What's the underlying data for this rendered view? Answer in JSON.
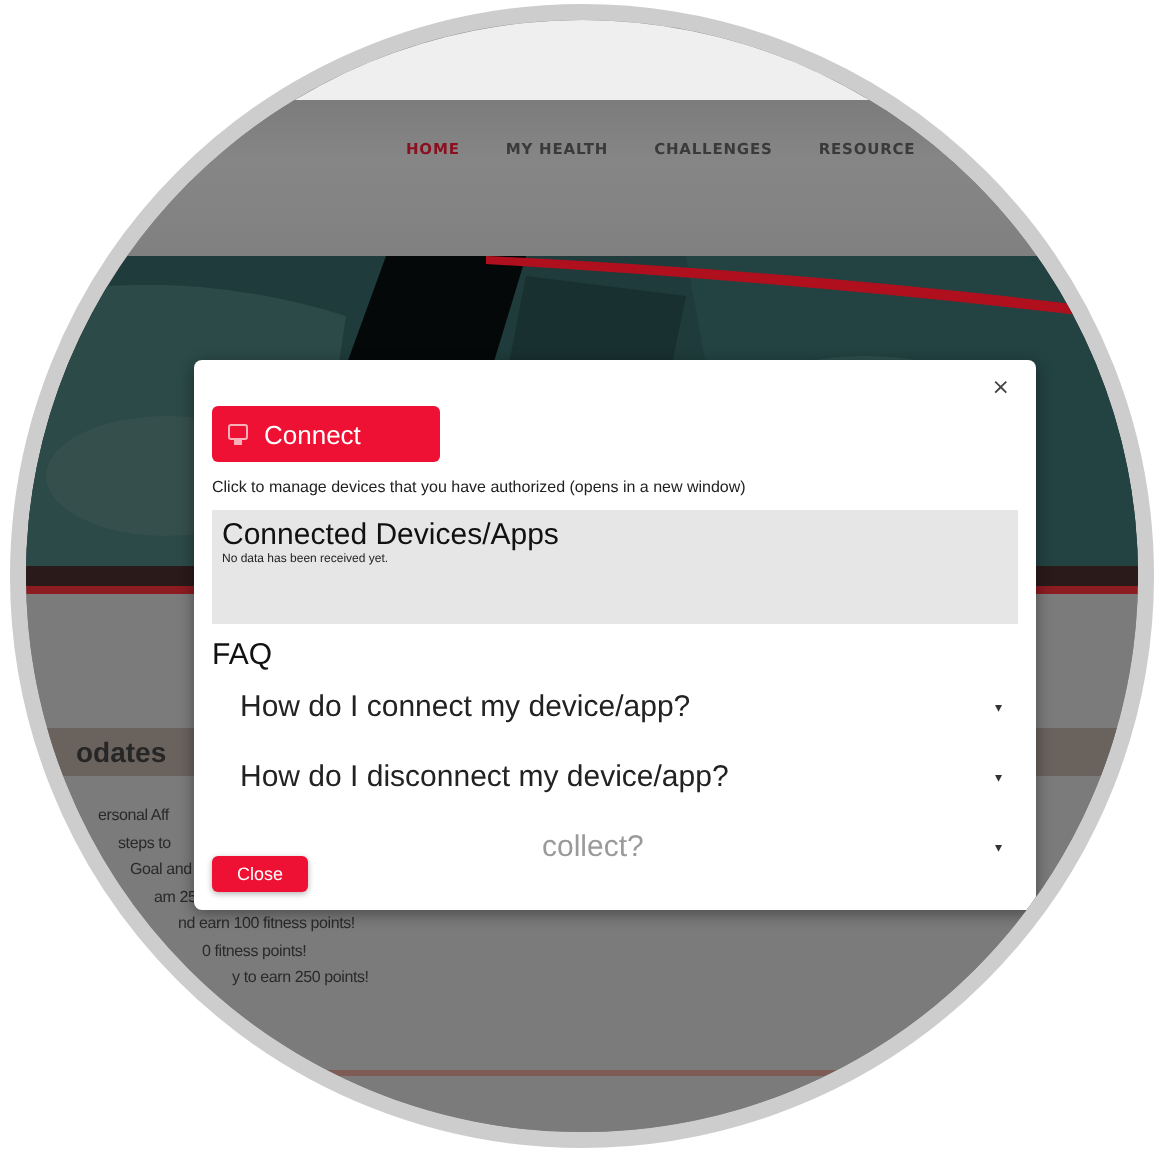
{
  "nav": {
    "items": [
      {
        "label": "HOME",
        "selected": true
      },
      {
        "label": "MY HEALTH",
        "selected": false
      },
      {
        "label": "CHALLENGES",
        "selected": false
      },
      {
        "label": "RESOURCE",
        "selected": false
      }
    ]
  },
  "updates": {
    "heading": "odates",
    "lines": [
      "ersonal Aff",
      "steps to",
      "Goal and",
      "am 25",
      "nd earn 100 fitness points!",
      "0 fitness points!",
      "y to earn 250 points!"
    ]
  },
  "modal": {
    "close_icon": "×",
    "connect_button": "Connect",
    "hint": "Click to manage devices that you have authorized (opens in a new window)",
    "devices_panel": {
      "title": "Connected Devices/Apps",
      "message": "No data has been received yet."
    },
    "faq": {
      "title": "FAQ",
      "items": [
        {
          "question": "How do I connect my device/app?",
          "caret": "▾",
          "faded": false
        },
        {
          "question": "How do I disconnect my device/app?",
          "caret": "▾",
          "faded": false
        },
        {
          "question": "collect?",
          "caret": "▾",
          "faded": true
        }
      ]
    },
    "close_button": "Close"
  }
}
